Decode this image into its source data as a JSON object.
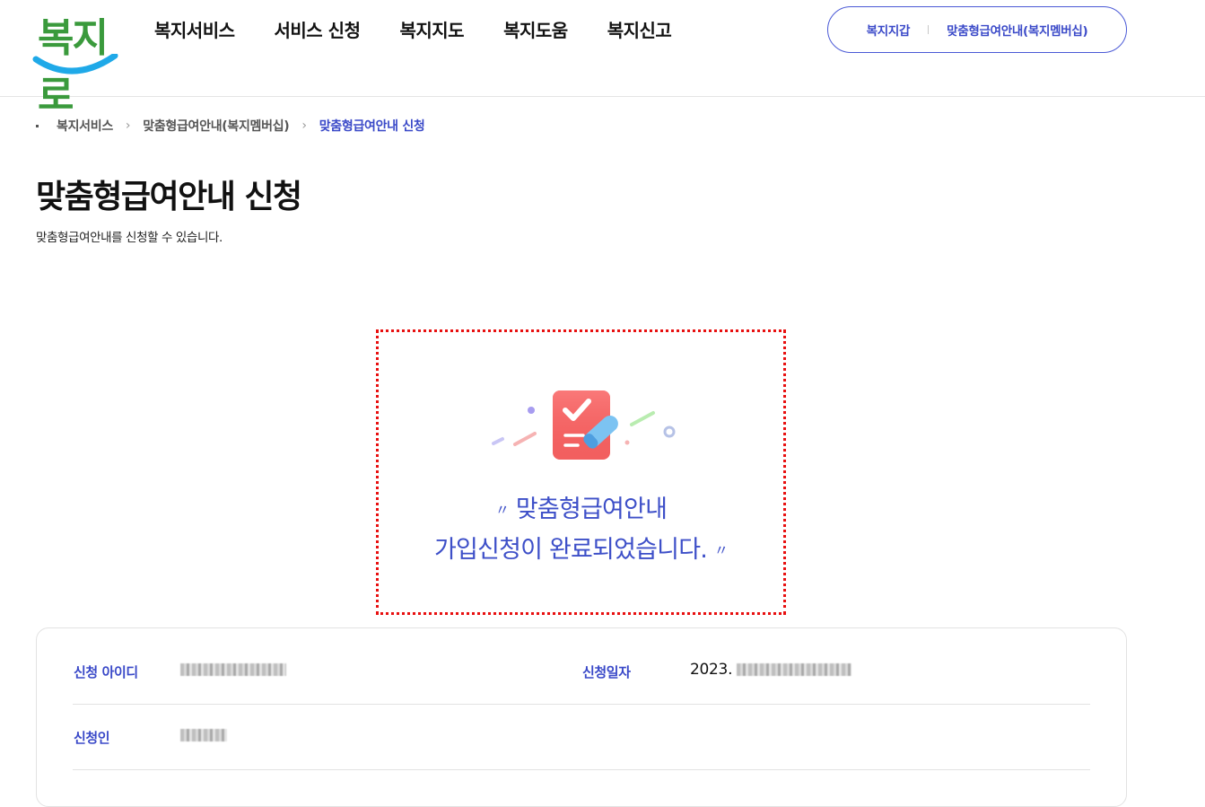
{
  "logo": {
    "text": "복지로"
  },
  "gnb": [
    "복지서비스",
    "서비스 신청",
    "복지지도",
    "복지도움",
    "복지신고"
  ],
  "util": [
    "복지지갑",
    "맞춤형급여안내(복지멤버십)"
  ],
  "breadcrumb": [
    "복지서비스",
    "맞춤형급여안내(복지멤버십)",
    "맞춤형급여안내 신청"
  ],
  "page": {
    "title": "맞춤형급여안내 신청",
    "desc": "맞춤형급여안내를 신청할 수 있습니다."
  },
  "complete": {
    "open_quote": "〃",
    "line1": "맞춤형급여안내",
    "line2": "가입신청이 완료되었습니다.",
    "close_quote": "〃"
  },
  "info": {
    "id_label": "신청 아이디",
    "date_label": "신청일자",
    "date_prefix": "2023.",
    "applicant_label": "신청인"
  },
  "colors": {
    "brand_blue": "#3a49c8",
    "highlight_red": "#e81010",
    "logo_green": "#3a9a3c",
    "logo_smile": "#1fa9e8"
  }
}
